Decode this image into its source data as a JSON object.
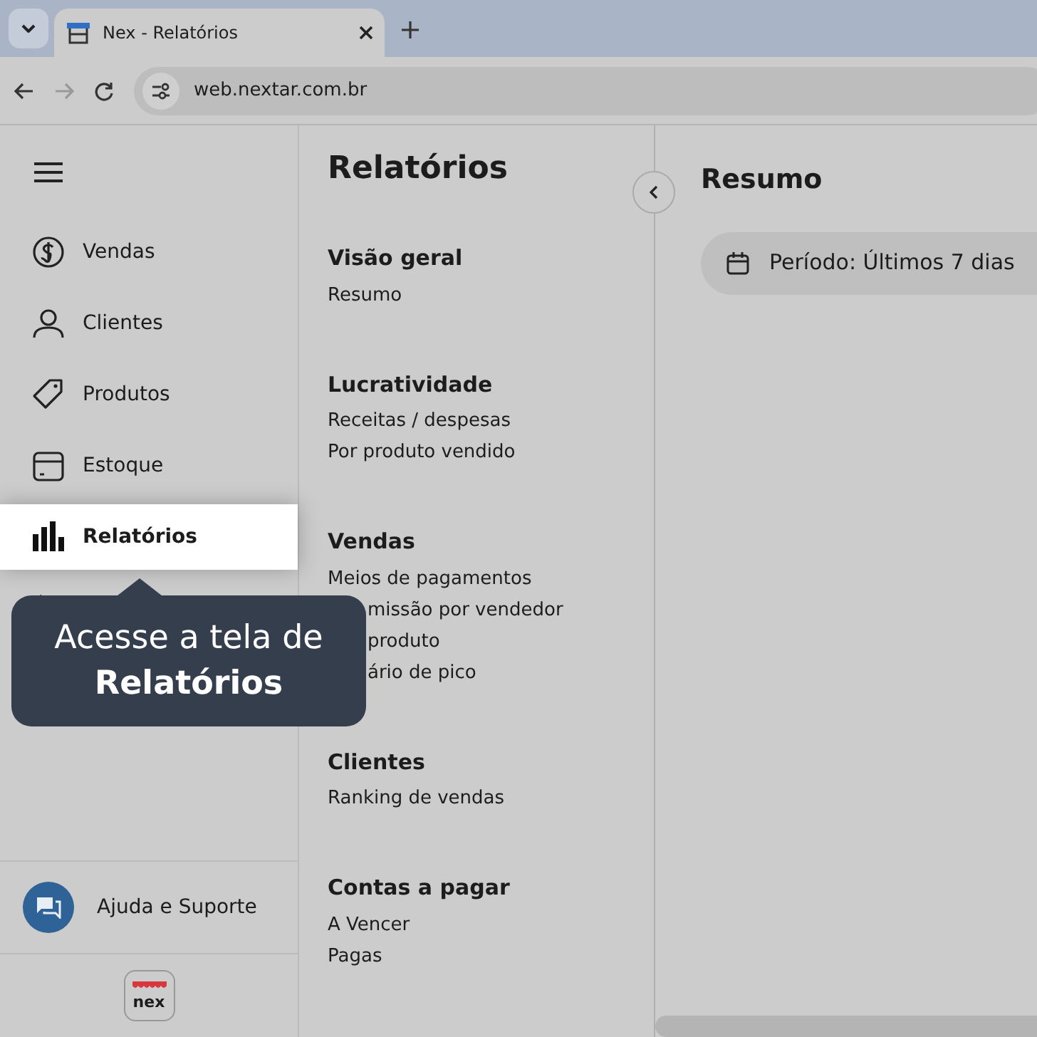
{
  "browser": {
    "tab_title": "Nex - Relatórios",
    "url": "web.nextar.com.br"
  },
  "sidebar": {
    "items": [
      {
        "kind": "sales",
        "label": "Vendas",
        "selected": false
      },
      {
        "kind": "customers",
        "label": "Clientes",
        "selected": false
      },
      {
        "kind": "products",
        "label": "Produtos",
        "selected": false
      },
      {
        "kind": "stock",
        "label": "Estoque",
        "selected": false
      },
      {
        "kind": "reports",
        "label": "Relatórios",
        "selected": true
      },
      {
        "kind": "integrations",
        "selected": false
      }
    ],
    "help": "Ajuda e Suporte",
    "logo_text": "nex"
  },
  "reports": {
    "title": "Relatórios",
    "sections": [
      {
        "heading": "Visão geral",
        "items": [
          "Resumo"
        ]
      },
      {
        "heading": "Lucratividade",
        "items": [
          "Receitas / despesas",
          "Por produto vendido"
        ]
      },
      {
        "heading": "Vendas",
        "items": [
          "Meios de pagamentos",
          {
            "text": "missão por vendedor",
            "covered": true
          },
          {
            "text": "produto",
            "covered": true
          },
          {
            "text": "ário de pico",
            "covered": true
          }
        ]
      },
      {
        "heading": "Clientes",
        "items": [
          "Ranking de vendas"
        ]
      },
      {
        "heading": "Contas a pagar",
        "items": [
          "A Vencer",
          "Pagas"
        ]
      }
    ]
  },
  "content": {
    "title": "Resumo",
    "period": "Período: Últimos 7 dias"
  },
  "tooltip": {
    "text": "Acesse a tela de",
    "bold_text": "Relatórios"
  }
}
